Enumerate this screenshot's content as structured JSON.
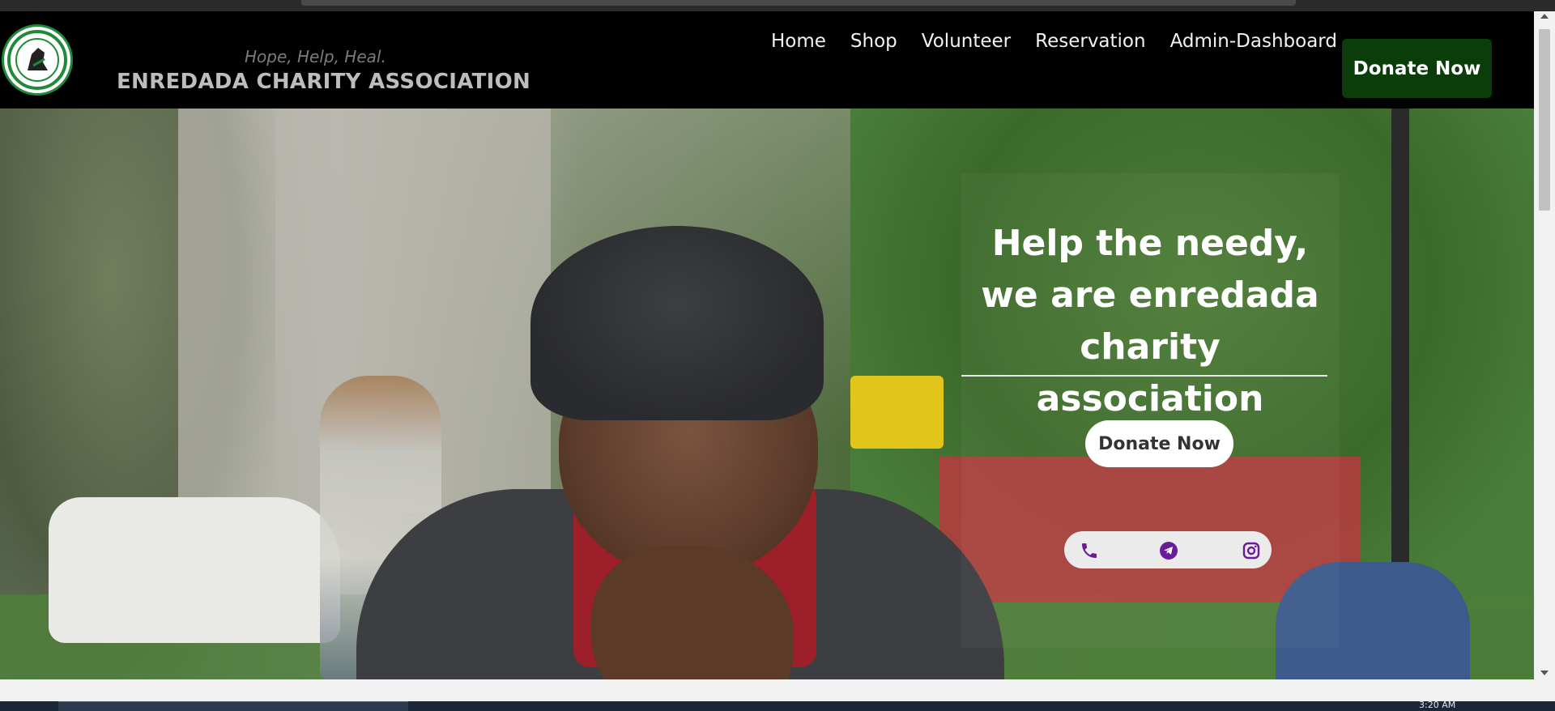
{
  "site": {
    "tagline": "Hope, Help, Heal.",
    "brand": "ENREDADA CHARITY ASSOCIATION"
  },
  "nav": {
    "items": [
      {
        "label": "Home"
      },
      {
        "label": "Shop"
      },
      {
        "label": "Volunteer"
      },
      {
        "label": "Reservation"
      },
      {
        "label": "Admin-Dashboard"
      }
    ],
    "donate_label": "Donate Now"
  },
  "hero": {
    "title": "Help the needy, we are enredada charity association",
    "donate_label": "Donate Now",
    "social_icons": [
      "phone-icon",
      "telegram-icon",
      "instagram-icon"
    ]
  },
  "taskbar": {
    "clock": "3:20 AM"
  },
  "colors": {
    "navbar_bg": "#000000",
    "donate_bg": "#0b3d0b",
    "social_icon": "#6a1b9a",
    "logo_ring": "#1f8b3a"
  }
}
